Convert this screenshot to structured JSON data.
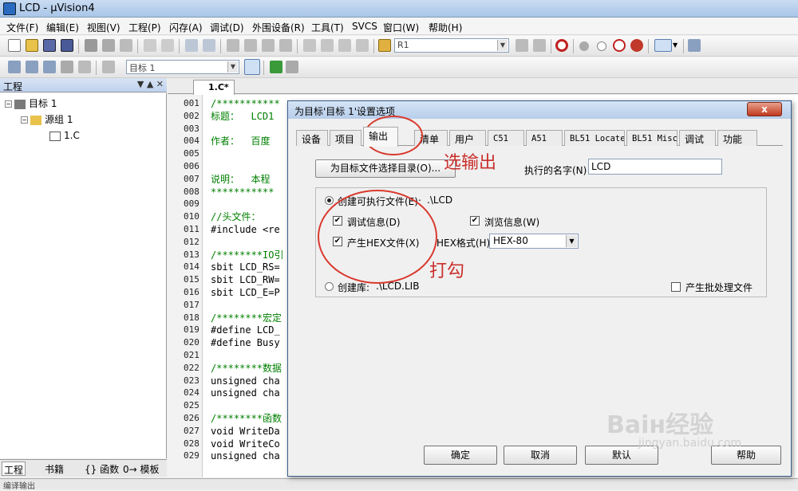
{
  "app": {
    "title": "LCD - µVision4"
  },
  "menu": [
    "文件(F)",
    "编辑(E)",
    "视图(V)",
    "工程(P)",
    "闪存(A)",
    "调试(D)",
    "外围设备(R)",
    "工具(T)",
    "SVCS",
    "窗口(W)",
    "帮助(H)"
  ],
  "toolbar": {
    "find_combo": "R1",
    "target_combo": "目标 1"
  },
  "project": {
    "header": "工程",
    "tree": {
      "target": "目标 1",
      "group": "源组 1",
      "file": "1.C"
    },
    "tabs": [
      "工程",
      "书籍",
      "{} 函数",
      "0→ 模板"
    ]
  },
  "editor": {
    "tab": "1.C*",
    "lines": [
      {
        "n": "001",
        "t": "/***********",
        "c": true
      },
      {
        "n": "002",
        "t": "标题：  LCD1",
        "c": true
      },
      {
        "n": "003",
        "t": "",
        "c": false
      },
      {
        "n": "004",
        "t": "作者：  百度",
        "c": true
      },
      {
        "n": "005",
        "t": "",
        "c": false
      },
      {
        "n": "006",
        "t": "",
        "c": false
      },
      {
        "n": "007",
        "t": "说明：  本程",
        "c": true
      },
      {
        "n": "008",
        "t": "***********",
        "c": true
      },
      {
        "n": "009",
        "t": "",
        "c": false
      },
      {
        "n": "010",
        "t": "//头文件：",
        "c": true
      },
      {
        "n": "011",
        "t": "#include <re",
        "c": false
      },
      {
        "n": "012",
        "t": "",
        "c": false
      },
      {
        "n": "013",
        "t": "/********IO引",
        "c": true
      },
      {
        "n": "014",
        "t": "sbit LCD_RS=",
        "c": false
      },
      {
        "n": "015",
        "t": "sbit LCD_RW=",
        "c": false
      },
      {
        "n": "016",
        "t": "sbit LCD_E=P",
        "c": false
      },
      {
        "n": "017",
        "t": "",
        "c": false
      },
      {
        "n": "018",
        "t": "/********宏定",
        "c": true
      },
      {
        "n": "019",
        "t": "#define LCD_",
        "c": false
      },
      {
        "n": "020",
        "t": "#define Busy",
        "c": false
      },
      {
        "n": "021",
        "t": "",
        "c": false
      },
      {
        "n": "022",
        "t": "/********数据",
        "c": true
      },
      {
        "n": "023",
        "t": "unsigned cha",
        "c": false
      },
      {
        "n": "024",
        "t": "unsigned cha",
        "c": false
      },
      {
        "n": "025",
        "t": "",
        "c": false
      },
      {
        "n": "026",
        "t": "/********函数",
        "c": true
      },
      {
        "n": "027",
        "t": "void WriteDa",
        "c": false
      },
      {
        "n": "028",
        "t": "void WriteCo",
        "c": false
      },
      {
        "n": "029",
        "t": "unsigned cha",
        "c": false
      }
    ]
  },
  "status": "编译输出",
  "dialog": {
    "title": "为目标'目标 1'设置选项",
    "close": "x",
    "tabs": [
      "设备",
      "项目",
      "输出",
      "清单",
      "用户",
      "C51",
      "A51",
      "BL51 Locate",
      "BL51 Misc",
      "调试",
      "功能"
    ],
    "active_tab": "输出",
    "select_dir_button": "为目标文件选择目录(O)...",
    "exe_name_label": "执行的名字(N)",
    "exe_name_value": "LCD",
    "create_exe": {
      "label": "创建可执行文件(E):",
      "path": ".\\LCD",
      "selected": true
    },
    "debug_info": {
      "label": "调试信息(D)",
      "checked": true
    },
    "browse_info": {
      "label": "浏览信息(W)",
      "checked": true
    },
    "create_hex": {
      "label": "产生HEX文件(X)",
      "checked": true
    },
    "hex_format": {
      "label": "HEX格式(H):",
      "value": "HEX-80"
    },
    "create_lib": {
      "label": "创建库:",
      "path": ".\\LCD.LIB",
      "selected": false
    },
    "batch_file": {
      "label": "产生批处理文件",
      "checked": false
    },
    "buttons": {
      "ok": "确定",
      "cancel": "取消",
      "defaults": "默认",
      "help": "帮助"
    }
  },
  "annotations": {
    "select_output": "选输出",
    "tick": "打勾"
  },
  "watermark": {
    "main": "Baiʜ经验",
    "sub": "jingyan.baidu.com"
  }
}
